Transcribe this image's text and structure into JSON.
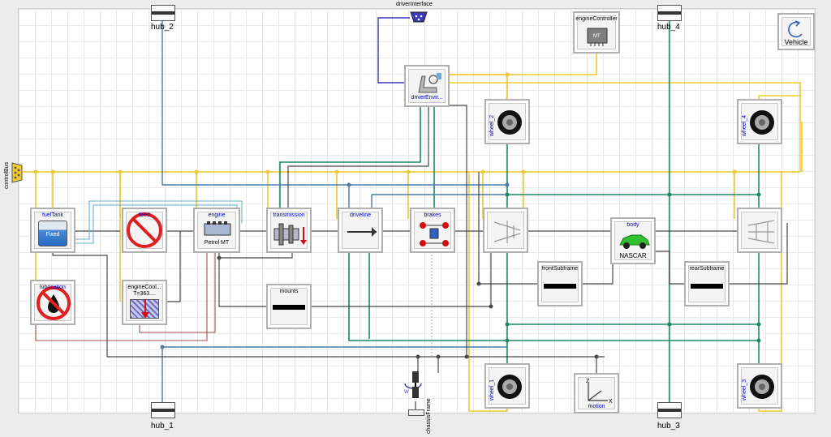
{
  "labels": {
    "driverInterface": "driverInterface",
    "controlBus": "controlBus",
    "hub_1": "hub_1",
    "hub_2": "hub_2",
    "hub_3": "hub_3",
    "hub_4": "hub_4",
    "chassisFrame": "chassisFrame"
  },
  "components": {
    "vehicle": "Vehicle",
    "engineController": "engineController",
    "engineController_sub": "MT",
    "driverEnvironment": "driverEnvir...",
    "wheel_1": "wheel_1",
    "wheel_2": "wheel_2",
    "wheel_3": "wheel_3",
    "wheel_4": "wheel_4",
    "fuelTank": "fuelTank",
    "fuelTank_sub": "Fixed",
    "feed": "feed",
    "engine": "engine",
    "engine_sub": "Petrol MT",
    "transmission": "transmission",
    "driveline": "driveline",
    "brakes": "brakes",
    "body": "body",
    "body_sub": "NASCAR",
    "frontSubframe": "frontSubframe",
    "rearSubframe": "rearSubframe",
    "lubrication": "lubrication",
    "engineCooling": "engineCool...",
    "engineCooling_sub": "T=363....",
    "mounts": "mounts",
    "motion": "motion"
  },
  "colors": {
    "bus": "#f0c830",
    "mech": "#1a8a60",
    "frame": "#6a8ab0",
    "signal": "#505050",
    "thermal": "#a05050",
    "fluid": "#60b0d0",
    "label": "#0000cc"
  }
}
